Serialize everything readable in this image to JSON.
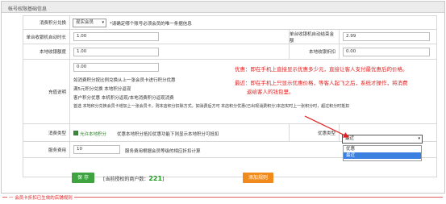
{
  "panel": {
    "title": "帐号权限基础信息"
  },
  "row1": {
    "label": "消费积分兑换",
    "select_value": "现实会员",
    "warning": "*请确定哪个账号必须会员的唯一条据信息"
  },
  "row2": {
    "label_left": "单台收银机自动时长",
    "value_left": "1.00",
    "label_right": "单台收银机自动结束金额",
    "value_right": "2.99"
  },
  "row3": {
    "label_left": "本地收银额度",
    "value_left": "1.00",
    "label_right": "本地收银折扣",
    "value_right": "0.00"
  },
  "row4": {
    "label": "充值说明",
    "value": "0.00",
    "lines": [
      "如消费积分按比例兑换从上一张会员卡进行积分优惠",
      "满5元积分兑换 本地积分返现",
      "客户积分优惠 本机积分返现/本地消费积分返现消费",
      "首选 本地积分兑换会员卡增加上一张会员卡，则本店积分扣除方式，如消费后方可 本店积分优惠(已出现消费积分)本店实时上一张积分时，超过积分时抵扣"
    ],
    "notes": [
      "优惠：即在手机上直接显示优惠多少元，直接让客人支付最优惠后的价格。",
      "最近：即在手机上只显示优惠价格，等客人起飞之后，系统才操作，将消费",
      "返给客人的钱包里。"
    ]
  },
  "row5": {
    "label": "消费类型",
    "checkbox_label": "允许本地积分",
    "desc": "优惠本地积分抵扣优惠功能下则显示本地积分可抵扣",
    "right_label": "优惠类型",
    "select_value": "最近",
    "options": [
      "优惠",
      "最近"
    ]
  },
  "row6": {
    "label": "服务费用",
    "value": "10",
    "desc": "服务费用根据会员等级的相应折扣计算"
  },
  "actions": {
    "save_label": "保 存",
    "counter_prefix": "[当前授权的商户数：",
    "counter_value": "221",
    "counter_suffix": "]",
    "add_label": "添加规则"
  },
  "bottom": {
    "legend": "一 会员卡折扣已生效的店铺规则"
  }
}
